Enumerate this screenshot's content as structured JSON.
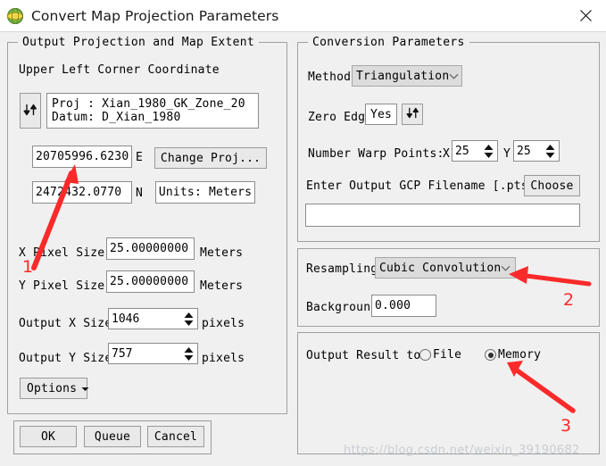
{
  "window": {
    "title": "Convert Map Projection Parameters",
    "app_icon": "globe-icon",
    "close_icon": "close-icon"
  },
  "left_panel": {
    "legend": "Output Projection and Map Extent",
    "subtitle": "Upper Left Corner Coordinate",
    "swap_icon": "down-up-arrows-icon",
    "projection": {
      "line1": "Proj : Xian_1980_GK_Zone_20",
      "line2": "Datum: D_Xian_1980"
    },
    "easting": {
      "value": "20705996.6230",
      "suffix": "E"
    },
    "northing": {
      "value": "2472432.0770",
      "suffix": "N"
    },
    "change_proj_label": "Change Proj...",
    "units_label": "Units: Meters",
    "x_pixel_size": {
      "label": "X Pixel Size",
      "value": "25.00000000",
      "unit": "Meters"
    },
    "y_pixel_size": {
      "label": "Y Pixel Size",
      "value": "25.00000000",
      "unit": "Meters"
    },
    "output_x_size": {
      "label": "Output X Size",
      "value": "1046",
      "unit": "pixels"
    },
    "output_y_size": {
      "label": "Output Y Size",
      "value": "757",
      "unit": "pixels"
    },
    "options_label": "Options",
    "options_icon": "chevron-down-icon"
  },
  "buttons": {
    "ok": "OK",
    "queue": "Queue",
    "cancel": "Cancel"
  },
  "conversion_panel": {
    "legend": "Conversion Parameters",
    "method": {
      "label": "Method",
      "value": "Triangulation",
      "icon": "chevron-down-icon"
    },
    "zero_edge": {
      "label": "Zero Edge",
      "value": "Yes",
      "swap_icon": "down-up-arrows-icon"
    },
    "warp_points": {
      "label": "Number Warp Points:",
      "x_label": "X",
      "x_value": "25",
      "y_label": "Y",
      "y_value": "25"
    },
    "gcp": {
      "label": "Enter Output GCP Filename [.pts]",
      "choose_label": "Choose",
      "value": ""
    }
  },
  "resampling_panel": {
    "resampling": {
      "label": "Resampling",
      "value": "Cubic Convolution",
      "icon": "chevron-down-icon"
    },
    "background": {
      "label": "Background",
      "value": "0.000"
    }
  },
  "output_panel": {
    "label": "Output Result to",
    "options": [
      {
        "label": "File",
        "selected": false
      },
      {
        "label": "Memory",
        "selected": true
      }
    ]
  },
  "annotations": {
    "one": "1",
    "two": "2",
    "three": "3",
    "color": "#fa2a2a"
  },
  "watermark": "https://blog.csdn.net/weixin_39190682"
}
